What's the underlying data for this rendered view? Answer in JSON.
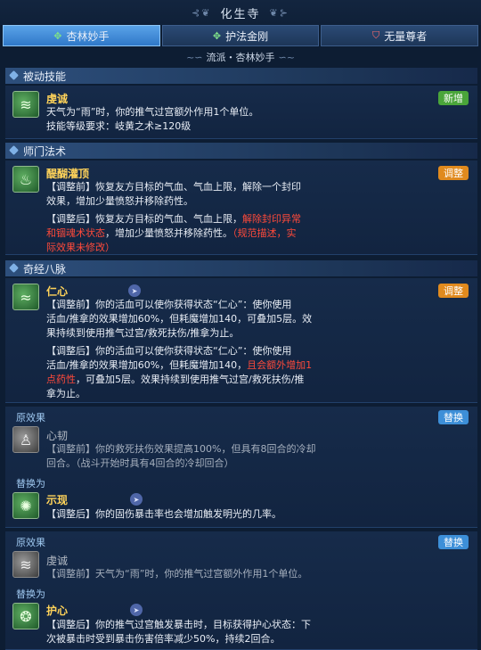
{
  "header": {
    "title": "化生寺"
  },
  "tabs": [
    {
      "label": "杏林妙手",
      "icon": "leaf-emblem-icon",
      "active": true
    },
    {
      "label": "护法金刚",
      "icon": "leaf-emblem-icon",
      "active": false
    },
    {
      "label": "无量尊者",
      "icon": "shield-emblem-icon",
      "active": false
    }
  ],
  "subtitle": "流派・杏林妙手",
  "passive": {
    "header": "被动技能",
    "skill": {
      "name": "虔诚",
      "badge": "新增",
      "line1": "天气为“雨”时，你的推气过宫额外作用1个单位。",
      "line2": "技能等级要求：岐黄之术≥120级"
    }
  },
  "sect": {
    "header": "师门法术",
    "skill": {
      "name": "醍醐灌顶",
      "badge": "调整",
      "before1": "【调整前】恢复友方目标的气血、气血上限，解除一个封印",
      "before2": "效果，增加少量愤怒并移除药性。",
      "after1a": "【调整后】恢复友方目标的气血、气血上限，",
      "after1b": "解除封印异常",
      "after2a": "和锢魂术状态",
      "after2b": "，增加少量愤怒并移除药性。",
      "after2c": "（规范描述，实",
      "after3": "际效果未修改）"
    }
  },
  "meridian": {
    "header": "奇经八脉",
    "skill": {
      "name": "仁心",
      "badge": "调整",
      "before1": "【调整前】你的活血可以使你获得状态“仁心”：使你使用",
      "before2": "活血/推拿的效果增加60%，但耗魔增加140，可叠加5层。效",
      "before3": "果持续到使用推气过宫/救死扶伤/推拿为止。",
      "after1": "【调整后】你的活血可以使你获得状态“仁心”：使你使用",
      "after2a": "活血/推拿的效果增加60%，但耗魔增加140，",
      "after2b": "且会额外增加1",
      "after3a": "点药性",
      "after3b": "，可叠加5层。效果持续到使用推气过宫/救死扶伤/推",
      "after4": "拿为止。"
    }
  },
  "replace1": {
    "original_label": "原效果",
    "badge": "替换",
    "original_name": "心韧",
    "original1": "【调整前】你的救死扶伤效果提高100%，但具有8回合的冷却",
    "original2": "回合。（战斗开始时具有4回合的冷却回合）",
    "replace_label": "替换为",
    "new_name": "示现",
    "new1": "【调整后】你的固伤暴击率也会增加触发明光的几率。"
  },
  "replace2": {
    "original_label": "原效果",
    "badge": "替换",
    "original_name": "虔诚",
    "original1": "【调整前】天气为“雨”时，你的推气过宫额外作用1个单位。",
    "replace_label": "替换为",
    "new_name": "护心",
    "new1": "【调整后】你的推气过宫触发暴击时，目标获得护心状态：下",
    "new2": "次被暴击时受到暴击伤害倍率减少50%，持续2回合。"
  },
  "colors": {
    "background": "#0d1d33",
    "skill_name": "#ffd35a",
    "highlight_red": "#ff4a3a",
    "badge_new": "#4aa53a",
    "badge_adjust": "#e08a1e",
    "badge_replace": "#3d8fd8",
    "tab_active": "#3f8ad8"
  }
}
